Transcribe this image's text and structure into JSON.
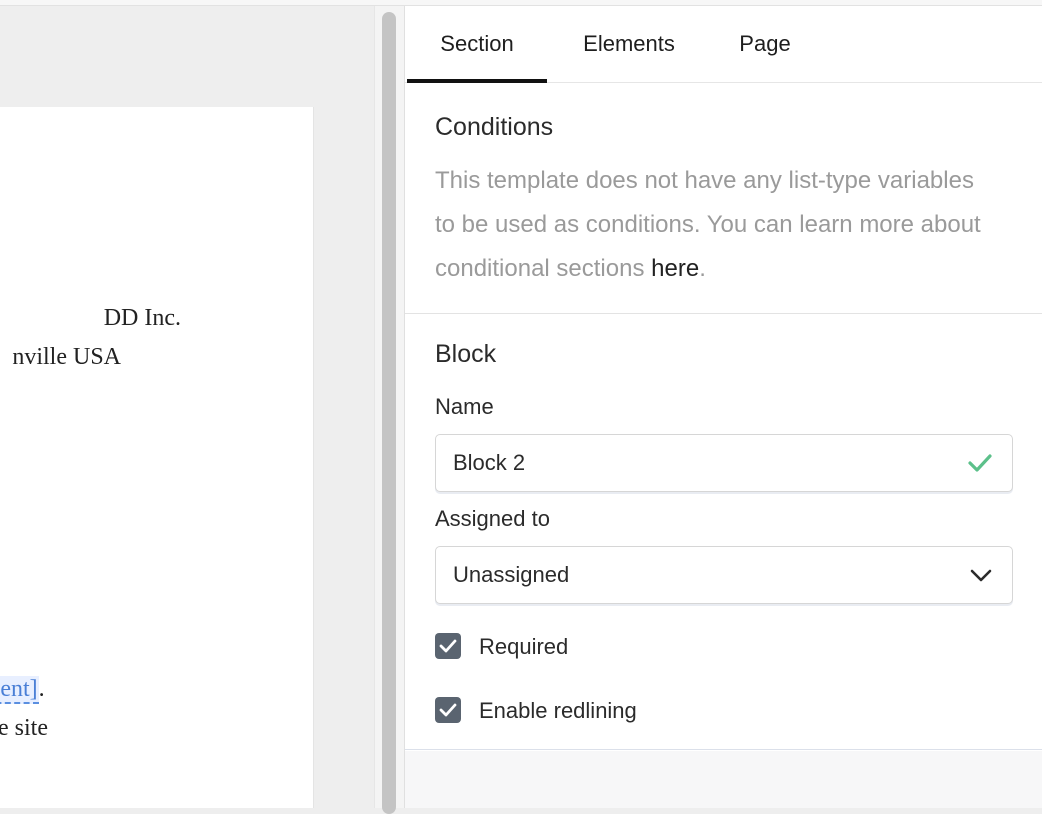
{
  "document": {
    "company": "DD Inc.",
    "city": "nville USA",
    "client_variable": "lient]",
    "client_suffix": ".",
    "site_text": "he site"
  },
  "panel": {
    "tabs": [
      {
        "label": "Section",
        "active": true
      },
      {
        "label": "Elements",
        "active": false
      },
      {
        "label": "Page",
        "active": false
      }
    ],
    "conditions": {
      "title": "Conditions",
      "text": "This template does not have any list-type variables to be used as conditions. You can learn more about conditional sections ",
      "link": "here",
      "suffix": "."
    },
    "block": {
      "title": "Block",
      "name_label": "Name",
      "name_value": "Block 2",
      "assigned_label": "Assigned to",
      "assigned_value": "Unassigned",
      "required_label": "Required",
      "required_checked": true,
      "redlining_label": "Enable redlining",
      "redlining_checked": true
    }
  },
  "icons": {
    "name_valid": "check-icon",
    "dropdown": "chevron-down-icon",
    "checkbox": "checkbox-checked-icon"
  },
  "colors": {
    "accent_tab": "#111111",
    "valid_check": "#5cc08a",
    "checkbox_fill": "#5a6470",
    "variable_link": "#4a7fd6",
    "muted_text": "#9a9a9a"
  }
}
